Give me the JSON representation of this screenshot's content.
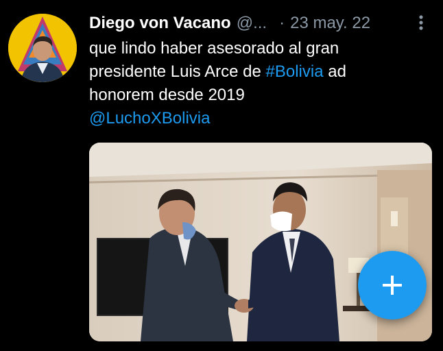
{
  "tweet": {
    "author_name": "Diego von Vacano",
    "author_handle": "@...",
    "separator": "·",
    "date": "23 may. 22",
    "text_line1": "que lindo haber asesorado al gran",
    "text_line2_a": "presidente Luis Arce de ",
    "text_line2_hashtag": "#Bolivia",
    "text_line2_b": " ad",
    "text_line3": "honorem desde 2019",
    "mention": "@LuchoXBolivia"
  },
  "colors": {
    "background": "#000000",
    "text": "#ffffff",
    "muted": "#8b98a5",
    "accent": "#1d9bf0",
    "avatar_bg": "#f2c300"
  },
  "icons": {
    "more": "more-vertical-icon",
    "compose": "plus-icon"
  }
}
